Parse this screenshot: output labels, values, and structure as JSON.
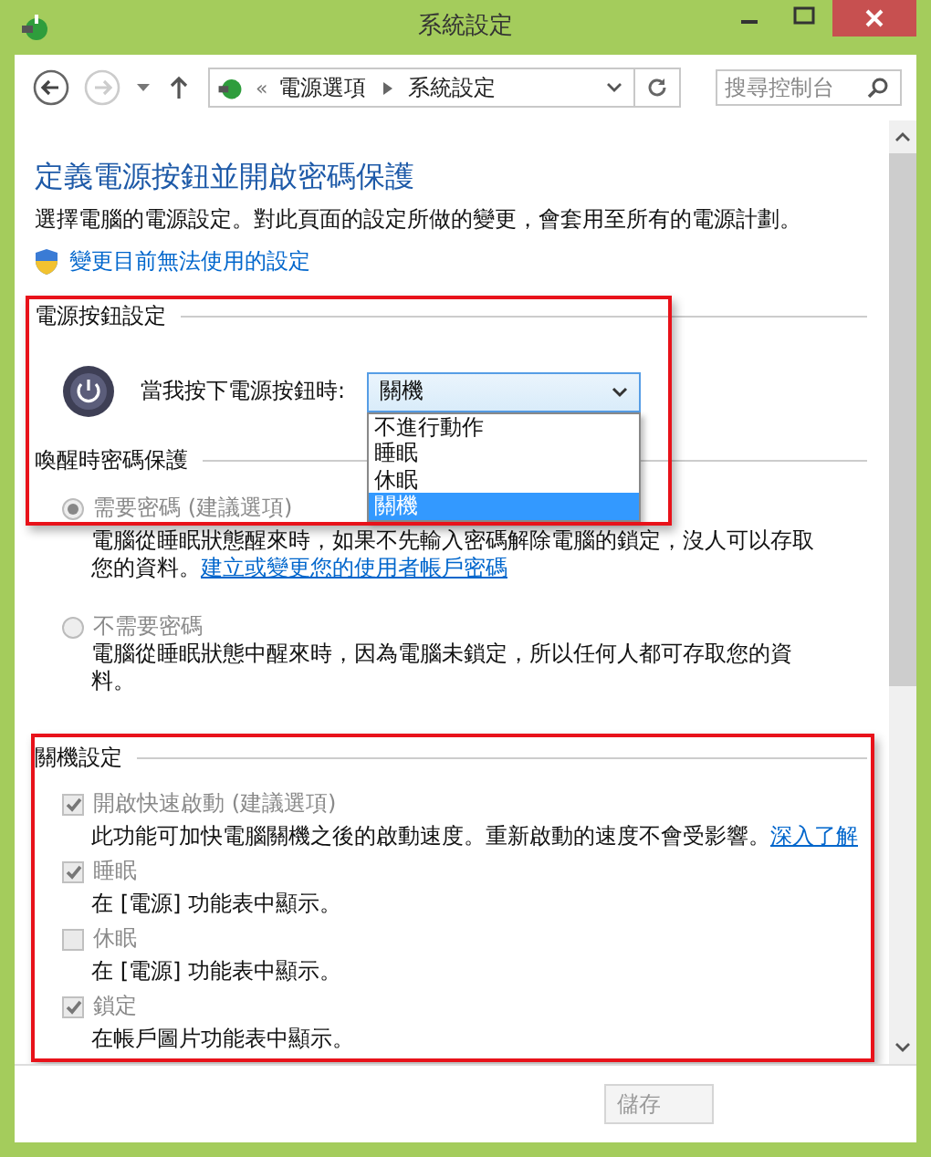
{
  "window": {
    "title": "系統設定"
  },
  "address_bar": {
    "separator": "«",
    "crumbs": [
      "電源選項",
      "系統設定"
    ]
  },
  "search": {
    "placeholder": "搜尋控制台"
  },
  "heading": "定義電源按鈕並開啟密碼保護",
  "description": "選擇電腦的電源設定。對此頁面的設定所做的變更，會套用至所有的電源計劃。",
  "admin_link": "變更目前無法使用的設定",
  "power_button": {
    "section": "電源按鈕設定",
    "label": "當我按下電源按鈕時:",
    "value": "關機",
    "expanded": true,
    "options": [
      {
        "label": "不進行動作",
        "selected": false
      },
      {
        "label": "睡眠",
        "selected": false
      },
      {
        "label": "休眠",
        "selected": false
      },
      {
        "label": "關機",
        "selected": true
      }
    ]
  },
  "wake_password": {
    "section": "喚醒時密碼保護",
    "disabled": true,
    "options": [
      {
        "label": "需要密碼 (建議選項)",
        "selected": true,
        "description": "電腦從睡眠狀態醒來時，如果不先輸入密碼解除電腦的鎖定，沒人可以存取您的資料。",
        "link": "建立或變更您的使用者帳戶密碼"
      },
      {
        "label": "不需要密碼",
        "selected": false,
        "description": "電腦從睡眠狀態中醒來時，因為電腦未鎖定，所以任何人都可存取您的資料。"
      }
    ]
  },
  "shutdown": {
    "section": "關機設定",
    "disabled": true,
    "items": [
      {
        "label": "開啟快速啟動 (建議選項)",
        "checked": true,
        "description": "此功能可加快電腦關機之後的啟動速度。重新啟動的速度不會受影響。",
        "link": "深入了解"
      },
      {
        "label": "睡眠",
        "checked": true,
        "description": "在 [電源] 功能表中顯示。"
      },
      {
        "label": "休眠",
        "checked": false,
        "description": "在 [電源] 功能表中顯示。"
      },
      {
        "label": "鎖定",
        "checked": true,
        "description": "在帳戶圖片功能表中顯示。"
      }
    ]
  },
  "save_button": {
    "label": "儲存",
    "disabled": true
  }
}
